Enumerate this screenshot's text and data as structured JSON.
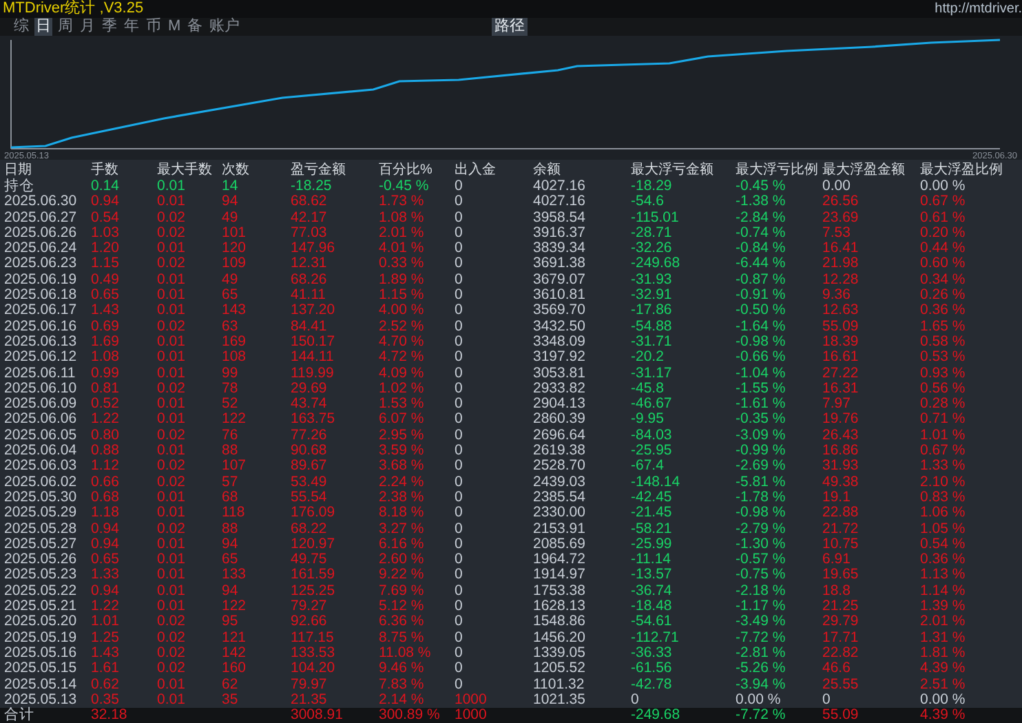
{
  "title": "MTDriver统计 ,V3.25",
  "url": "http://mtdriver.",
  "tabs": [
    {
      "label": "综",
      "selected": false
    },
    {
      "label": "日",
      "selected": true
    },
    {
      "label": "周",
      "selected": false
    },
    {
      "label": "月",
      "selected": false
    },
    {
      "label": "季",
      "selected": false
    },
    {
      "label": "年",
      "selected": false
    },
    {
      "label": "币",
      "selected": false
    },
    {
      "label": "M",
      "selected": false
    },
    {
      "label": "备",
      "selected": false
    },
    {
      "label": "账户",
      "selected": false
    }
  ],
  "view_tabs": [
    {
      "label": "路径",
      "selected": true
    }
  ],
  "chart": {
    "x_start": "2025.05.13",
    "x_end": "2025.06.30"
  },
  "table": {
    "columns": [
      "日期",
      "手数",
      "最大手数",
      "次数",
      "盈亏金额",
      "百分比%",
      "出入金",
      "余额",
      "最大浮亏金额",
      "最大浮亏比例",
      "最大浮盈金额",
      "最大浮盈比例"
    ],
    "rows": [
      {
        "kind": "holding",
        "cells": [
          "持仓",
          "0.14",
          "0.01",
          "14",
          "-18.25",
          "-0.45 %",
          "0",
          "4027.16",
          "-18.29",
          "-0.45 %",
          "0.00",
          "0.00 %"
        ]
      },
      {
        "kind": "day",
        "cells": [
          "2025.06.30",
          "0.94",
          "0.01",
          "94",
          "68.62",
          "1.73 %",
          "0",
          "4027.16",
          "-54.6",
          "-1.38 %",
          "26.56",
          "0.67 %"
        ]
      },
      {
        "kind": "day",
        "cells": [
          "2025.06.27",
          "0.54",
          "0.02",
          "49",
          "42.17",
          "1.08 %",
          "0",
          "3958.54",
          "-115.01",
          "-2.84 %",
          "23.69",
          "0.61 %"
        ]
      },
      {
        "kind": "day",
        "cells": [
          "2025.06.26",
          "1.03",
          "0.02",
          "101",
          "77.03",
          "2.01 %",
          "0",
          "3916.37",
          "-28.71",
          "-0.74 %",
          "7.53",
          "0.20 %"
        ]
      },
      {
        "kind": "day",
        "cells": [
          "2025.06.24",
          "1.20",
          "0.01",
          "120",
          "147.96",
          "4.01 %",
          "0",
          "3839.34",
          "-32.26",
          "-0.84 %",
          "16.41",
          "0.44 %"
        ]
      },
      {
        "kind": "day",
        "cells": [
          "2025.06.23",
          "1.15",
          "0.02",
          "109",
          "12.31",
          "0.33 %",
          "0",
          "3691.38",
          "-249.68",
          "-6.44 %",
          "21.98",
          "0.60 %"
        ]
      },
      {
        "kind": "day",
        "cells": [
          "2025.06.19",
          "0.49",
          "0.01",
          "49",
          "68.26",
          "1.89 %",
          "0",
          "3679.07",
          "-31.93",
          "-0.87 %",
          "12.28",
          "0.34 %"
        ]
      },
      {
        "kind": "day",
        "cells": [
          "2025.06.18",
          "0.65",
          "0.01",
          "65",
          "41.11",
          "1.15 %",
          "0",
          "3610.81",
          "-32.91",
          "-0.91 %",
          "9.36",
          "0.26 %"
        ]
      },
      {
        "kind": "day",
        "cells": [
          "2025.06.17",
          "1.43",
          "0.01",
          "143",
          "137.20",
          "4.00 %",
          "0",
          "3569.70",
          "-17.86",
          "-0.50 %",
          "12.63",
          "0.36 %"
        ]
      },
      {
        "kind": "day",
        "cells": [
          "2025.06.16",
          "0.69",
          "0.02",
          "63",
          "84.41",
          "2.52 %",
          "0",
          "3432.50",
          "-54.88",
          "-1.64 %",
          "55.09",
          "1.65 %"
        ]
      },
      {
        "kind": "day",
        "cells": [
          "2025.06.13",
          "1.69",
          "0.01",
          "169",
          "150.17",
          "4.70 %",
          "0",
          "3348.09",
          "-31.71",
          "-0.98 %",
          "18.39",
          "0.58 %"
        ]
      },
      {
        "kind": "day",
        "cells": [
          "2025.06.12",
          "1.08",
          "0.01",
          "108",
          "144.11",
          "4.72 %",
          "0",
          "3197.92",
          "-20.2",
          "-0.66 %",
          "16.61",
          "0.53 %"
        ]
      },
      {
        "kind": "day",
        "cells": [
          "2025.06.11",
          "0.99",
          "0.01",
          "99",
          "119.99",
          "4.09 %",
          "0",
          "3053.81",
          "-31.17",
          "-1.04 %",
          "27.22",
          "0.93 %"
        ]
      },
      {
        "kind": "day",
        "cells": [
          "2025.06.10",
          "0.81",
          "0.02",
          "78",
          "29.69",
          "1.02 %",
          "0",
          "2933.82",
          "-45.8",
          "-1.55 %",
          "16.31",
          "0.56 %"
        ]
      },
      {
        "kind": "day",
        "cells": [
          "2025.06.09",
          "0.52",
          "0.01",
          "52",
          "43.74",
          "1.53 %",
          "0",
          "2904.13",
          "-46.67",
          "-1.61 %",
          "7.97",
          "0.28 %"
        ]
      },
      {
        "kind": "day",
        "cells": [
          "2025.06.06",
          "1.22",
          "0.01",
          "122",
          "163.75",
          "6.07 %",
          "0",
          "2860.39",
          "-9.95",
          "-0.35 %",
          "19.76",
          "0.71 %"
        ]
      },
      {
        "kind": "day",
        "cells": [
          "2025.06.05",
          "0.80",
          "0.02",
          "76",
          "77.26",
          "2.95 %",
          "0",
          "2696.64",
          "-84.03",
          "-3.09 %",
          "26.43",
          "1.01 %"
        ]
      },
      {
        "kind": "day",
        "cells": [
          "2025.06.04",
          "0.88",
          "0.01",
          "88",
          "90.68",
          "3.59 %",
          "0",
          "2619.38",
          "-25.95",
          "-0.99 %",
          "16.86",
          "0.67 %"
        ]
      },
      {
        "kind": "day",
        "cells": [
          "2025.06.03",
          "1.12",
          "0.02",
          "107",
          "89.67",
          "3.68 %",
          "0",
          "2528.70",
          "-67.4",
          "-2.69 %",
          "31.93",
          "1.33 %"
        ]
      },
      {
        "kind": "day",
        "cells": [
          "2025.06.02",
          "0.66",
          "0.02",
          "57",
          "53.49",
          "2.24 %",
          "0",
          "2439.03",
          "-148.14",
          "-5.81 %",
          "49.38",
          "2.10 %"
        ]
      },
      {
        "kind": "day",
        "cells": [
          "2025.05.30",
          "0.68",
          "0.01",
          "68",
          "55.54",
          "2.38 %",
          "0",
          "2385.54",
          "-42.45",
          "-1.78 %",
          "19.1",
          "0.83 %"
        ]
      },
      {
        "kind": "day",
        "cells": [
          "2025.05.29",
          "1.18",
          "0.01",
          "118",
          "176.09",
          "8.18 %",
          "0",
          "2330.00",
          "-21.45",
          "-0.98 %",
          "22.88",
          "1.06 %"
        ]
      },
      {
        "kind": "day",
        "cells": [
          "2025.05.28",
          "0.94",
          "0.02",
          "88",
          "68.22",
          "3.27 %",
          "0",
          "2153.91",
          "-58.21",
          "-2.79 %",
          "21.72",
          "1.05 %"
        ]
      },
      {
        "kind": "day",
        "cells": [
          "2025.05.27",
          "0.94",
          "0.01",
          "94",
          "120.97",
          "6.16 %",
          "0",
          "2085.69",
          "-25.99",
          "-1.30 %",
          "10.75",
          "0.54 %"
        ]
      },
      {
        "kind": "day",
        "cells": [
          "2025.05.26",
          "0.65",
          "0.01",
          "65",
          "49.75",
          "2.60 %",
          "0",
          "1964.72",
          "-11.14",
          "-0.57 %",
          "6.91",
          "0.36 %"
        ]
      },
      {
        "kind": "day",
        "cells": [
          "2025.05.23",
          "1.33",
          "0.01",
          "133",
          "161.59",
          "9.22 %",
          "0",
          "1914.97",
          "-13.57",
          "-0.75 %",
          "19.65",
          "1.13 %"
        ]
      },
      {
        "kind": "day",
        "cells": [
          "2025.05.22",
          "0.94",
          "0.01",
          "94",
          "125.25",
          "7.69 %",
          "0",
          "1753.38",
          "-36.74",
          "-2.18 %",
          "18.8",
          "1.14 %"
        ]
      },
      {
        "kind": "day",
        "cells": [
          "2025.05.21",
          "1.22",
          "0.01",
          "122",
          "79.27",
          "5.12 %",
          "0",
          "1628.13",
          "-18.48",
          "-1.17 %",
          "21.25",
          "1.39 %"
        ]
      },
      {
        "kind": "day",
        "cells": [
          "2025.05.20",
          "1.01",
          "0.02",
          "95",
          "92.66",
          "6.36 %",
          "0",
          "1548.86",
          "-54.61",
          "-3.49 %",
          "29.79",
          "2.01 %"
        ]
      },
      {
        "kind": "day",
        "cells": [
          "2025.05.19",
          "1.25",
          "0.02",
          "121",
          "117.15",
          "8.75 %",
          "0",
          "1456.20",
          "-112.71",
          "-7.72 %",
          "17.71",
          "1.31 %"
        ]
      },
      {
        "kind": "day",
        "cells": [
          "2025.05.16",
          "1.43",
          "0.02",
          "142",
          "133.53",
          "11.08 %",
          "0",
          "1339.05",
          "-36.33",
          "-2.81 %",
          "22.82",
          "1.81 %"
        ]
      },
      {
        "kind": "day",
        "cells": [
          "2025.05.15",
          "1.61",
          "0.02",
          "160",
          "104.20",
          "9.46 %",
          "0",
          "1205.52",
          "-61.56",
          "-5.26 %",
          "46.6",
          "4.39 %"
        ]
      },
      {
        "kind": "day",
        "cells": [
          "2025.05.14",
          "0.62",
          "0.01",
          "62",
          "79.97",
          "7.83 %",
          "0",
          "1101.32",
          "-42.78",
          "-3.94 %",
          "25.55",
          "2.51 %"
        ]
      },
      {
        "kind": "deposit",
        "cells": [
          "2025.05.13",
          "0.35",
          "0.01",
          "35",
          "21.35",
          "2.14 %",
          "1000",
          "1021.35",
          "0",
          "0.00 %",
          "0",
          "0.00 %"
        ]
      },
      {
        "kind": "total",
        "cells": [
          "合计",
          "32.18",
          null,
          null,
          "3008.91",
          "300.89 %",
          "1000",
          null,
          "-249.68",
          "-7.72 %",
          "55.09",
          "4.39 %"
        ]
      }
    ]
  }
}
